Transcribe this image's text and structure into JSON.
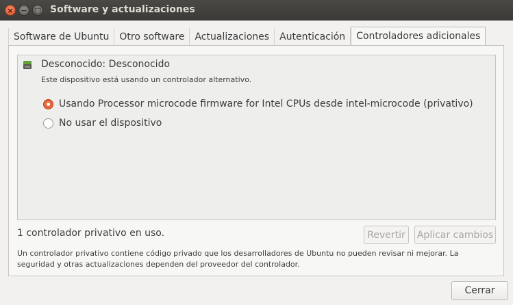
{
  "window": {
    "title": "Software y actualizaciones",
    "controls": {
      "close": "×",
      "minimize": "−",
      "maximize": "□"
    }
  },
  "tabs": [
    {
      "label": "Software de Ubuntu",
      "active": false
    },
    {
      "label": "Otro software",
      "active": false
    },
    {
      "label": "Actualizaciones",
      "active": false
    },
    {
      "label": "Autenticación",
      "active": false
    },
    {
      "label": "Controladores adicionales",
      "active": true
    }
  ],
  "device": {
    "icon": "chip-icon",
    "title": "Desconocido: Desconocido",
    "subtitle": "Este dispositivo está usando un controlador alternativo.",
    "options": [
      {
        "label": "Usando Processor microcode firmware for Intel CPUs desde intel-microcode (privativo)",
        "checked": true
      },
      {
        "label": "No usar el dispositivo",
        "checked": false
      }
    ]
  },
  "status": "1 controlador privativo en uso.",
  "buttons": {
    "revert": "Revertir",
    "apply": "Aplicar cambios",
    "close": "Cerrar"
  },
  "note": "Un controlador privativo contiene código privado que los desarrolladores de Ubuntu no pueden revisar ni mejorar. La seguridad y otras actualizaciones dependen del proveedor del controlador.",
  "colors": {
    "accent": "#e8643b",
    "titlebar": "#3b3a36"
  }
}
